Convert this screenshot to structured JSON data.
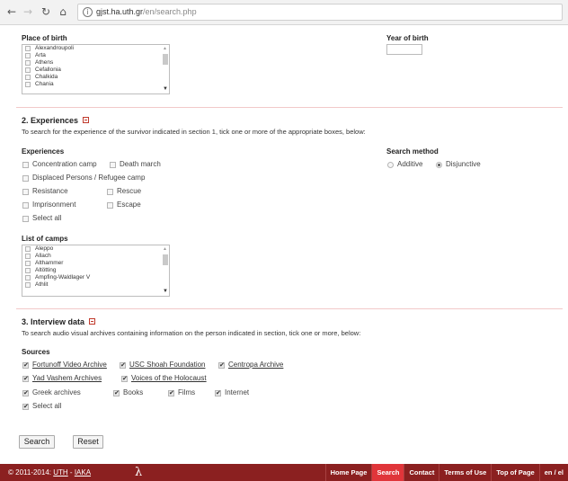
{
  "browser": {
    "url_host": "gjst.ha.uth.gr",
    "url_path": "/en/search.php"
  },
  "birth": {
    "place_label": "Place of birth",
    "places": [
      "Alexandroupoli",
      "Arta",
      "Athens",
      "Cefallonia",
      "Chalkida",
      "Chania"
    ],
    "year_label": "Year of birth",
    "year_value": ""
  },
  "experiences": {
    "title": "2. Experiences",
    "description": "To search for the experience of the survivor indicated in section 1, tick one or more of the appropriate boxes, below:",
    "label": "Experiences",
    "options": {
      "concentration_camp": "Concentration camp",
      "death_march": "Death march",
      "displaced": "Displaced Persons / Refugee camp",
      "resistance": "Resistance",
      "rescue": "Rescue",
      "imprisonment": "Imprisonment",
      "escape": "Escape",
      "select_all": "Select all"
    },
    "search_method_label": "Search method",
    "methods": {
      "additive": "Additive",
      "disjunctive": "Disjunctive",
      "selected": "Disjunctive"
    },
    "camps_label": "List of camps",
    "camps": [
      "Aleppo",
      "Allach",
      "Althammer",
      "Altötting",
      "Ampfing-Waldlager V",
      "Athlit"
    ]
  },
  "interview": {
    "title": "3. Interview data",
    "description": "To search audio visual archives containing information on the person indicated in section, tick one or more, below:",
    "sources_label": "Sources",
    "sources": {
      "fortunoff": "Fortunoff Video Archive",
      "usc": "USC Shoah Foundation",
      "centropa": "Centropa Archive",
      "yad_vashem": "Yad Vashem Archives",
      "voices": "Voices of the Holocaust",
      "greek": "Greek archives",
      "books": "Books",
      "films": "Films",
      "internet": "Internet",
      "select_all": "Select all"
    }
  },
  "buttons": {
    "search": "Search",
    "reset": "Reset"
  },
  "footer": {
    "copyright": "© 2011-2014:",
    "uth": "UTH",
    "separator": " - ",
    "iaka": "IAKA",
    "logo_glyph": "λ",
    "nav": [
      "Home Page",
      "Search",
      "Contact",
      "Terms of Use",
      "Top of Page",
      "en / el"
    ],
    "active_nav": "Search"
  },
  "colors": {
    "footer_bg": "#8b2020",
    "footer_active": "#e0353a",
    "accent": "#c0392b"
  }
}
